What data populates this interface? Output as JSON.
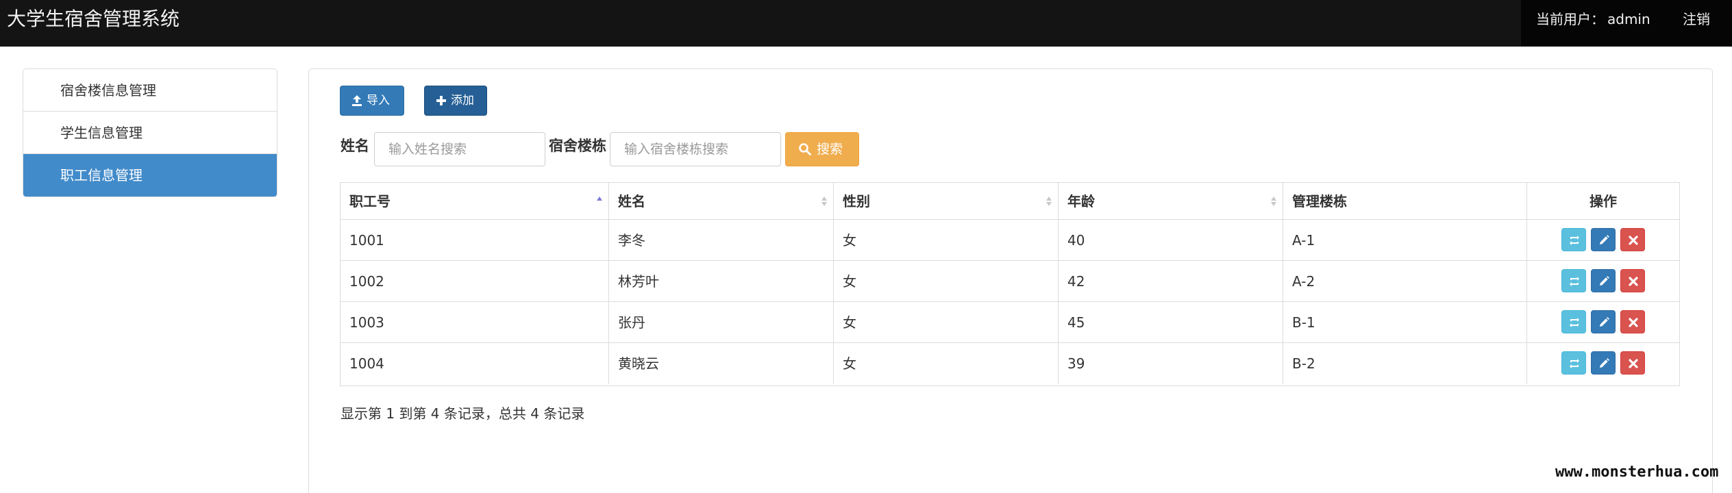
{
  "navbar": {
    "brand": "大学生宿舍管理系统",
    "user_label": "当前用户：",
    "user_name": "admin",
    "logout": "注销"
  },
  "sidebar": {
    "items": [
      {
        "label": "宿舍楼信息管理"
      },
      {
        "label": "学生信息管理"
      },
      {
        "label": "职工信息管理",
        "active": true
      }
    ]
  },
  "toolbar": {
    "import_label": "导入",
    "add_label": "添加",
    "import_icon": "upload-icon",
    "add_icon": "plus-icon"
  },
  "search": {
    "name_label": "姓名",
    "name_placeholder": "输入姓名搜索",
    "building_label": "宿舍楼栋",
    "building_placeholder": "输入宿舍楼栋搜索",
    "search_label": "搜索",
    "search_icon": "search-icon"
  },
  "table": {
    "headers": [
      "职工号",
      "姓名",
      "性别",
      "年龄",
      "管理楼栋",
      "操作"
    ],
    "sorted_column": "职工号",
    "sort_direction": "asc",
    "rows": [
      {
        "id": "1001",
        "name": "李冬",
        "gender": "女",
        "age": "40",
        "building": "A-1"
      },
      {
        "id": "1002",
        "name": "林芳叶",
        "gender": "女",
        "age": "42",
        "building": "A-2"
      },
      {
        "id": "1003",
        "name": "张丹",
        "gender": "女",
        "age": "45",
        "building": "B-1"
      },
      {
        "id": "1004",
        "name": "黄晓云",
        "gender": "女",
        "age": "39",
        "building": "B-2"
      }
    ],
    "row_actions": [
      "refresh-icon",
      "pencil-icon",
      "close-icon"
    ]
  },
  "pagination": {
    "summary": "显示第 1 到第 4 条记录，总共 4 条记录"
  },
  "watermark": "www.monsterhua.com",
  "colors": {
    "navbar": "#141414",
    "primary": "#337ab7",
    "active_item": "#428bca",
    "warning": "#f0ad4e",
    "info": "#5bc0de",
    "danger": "#d9534f"
  }
}
